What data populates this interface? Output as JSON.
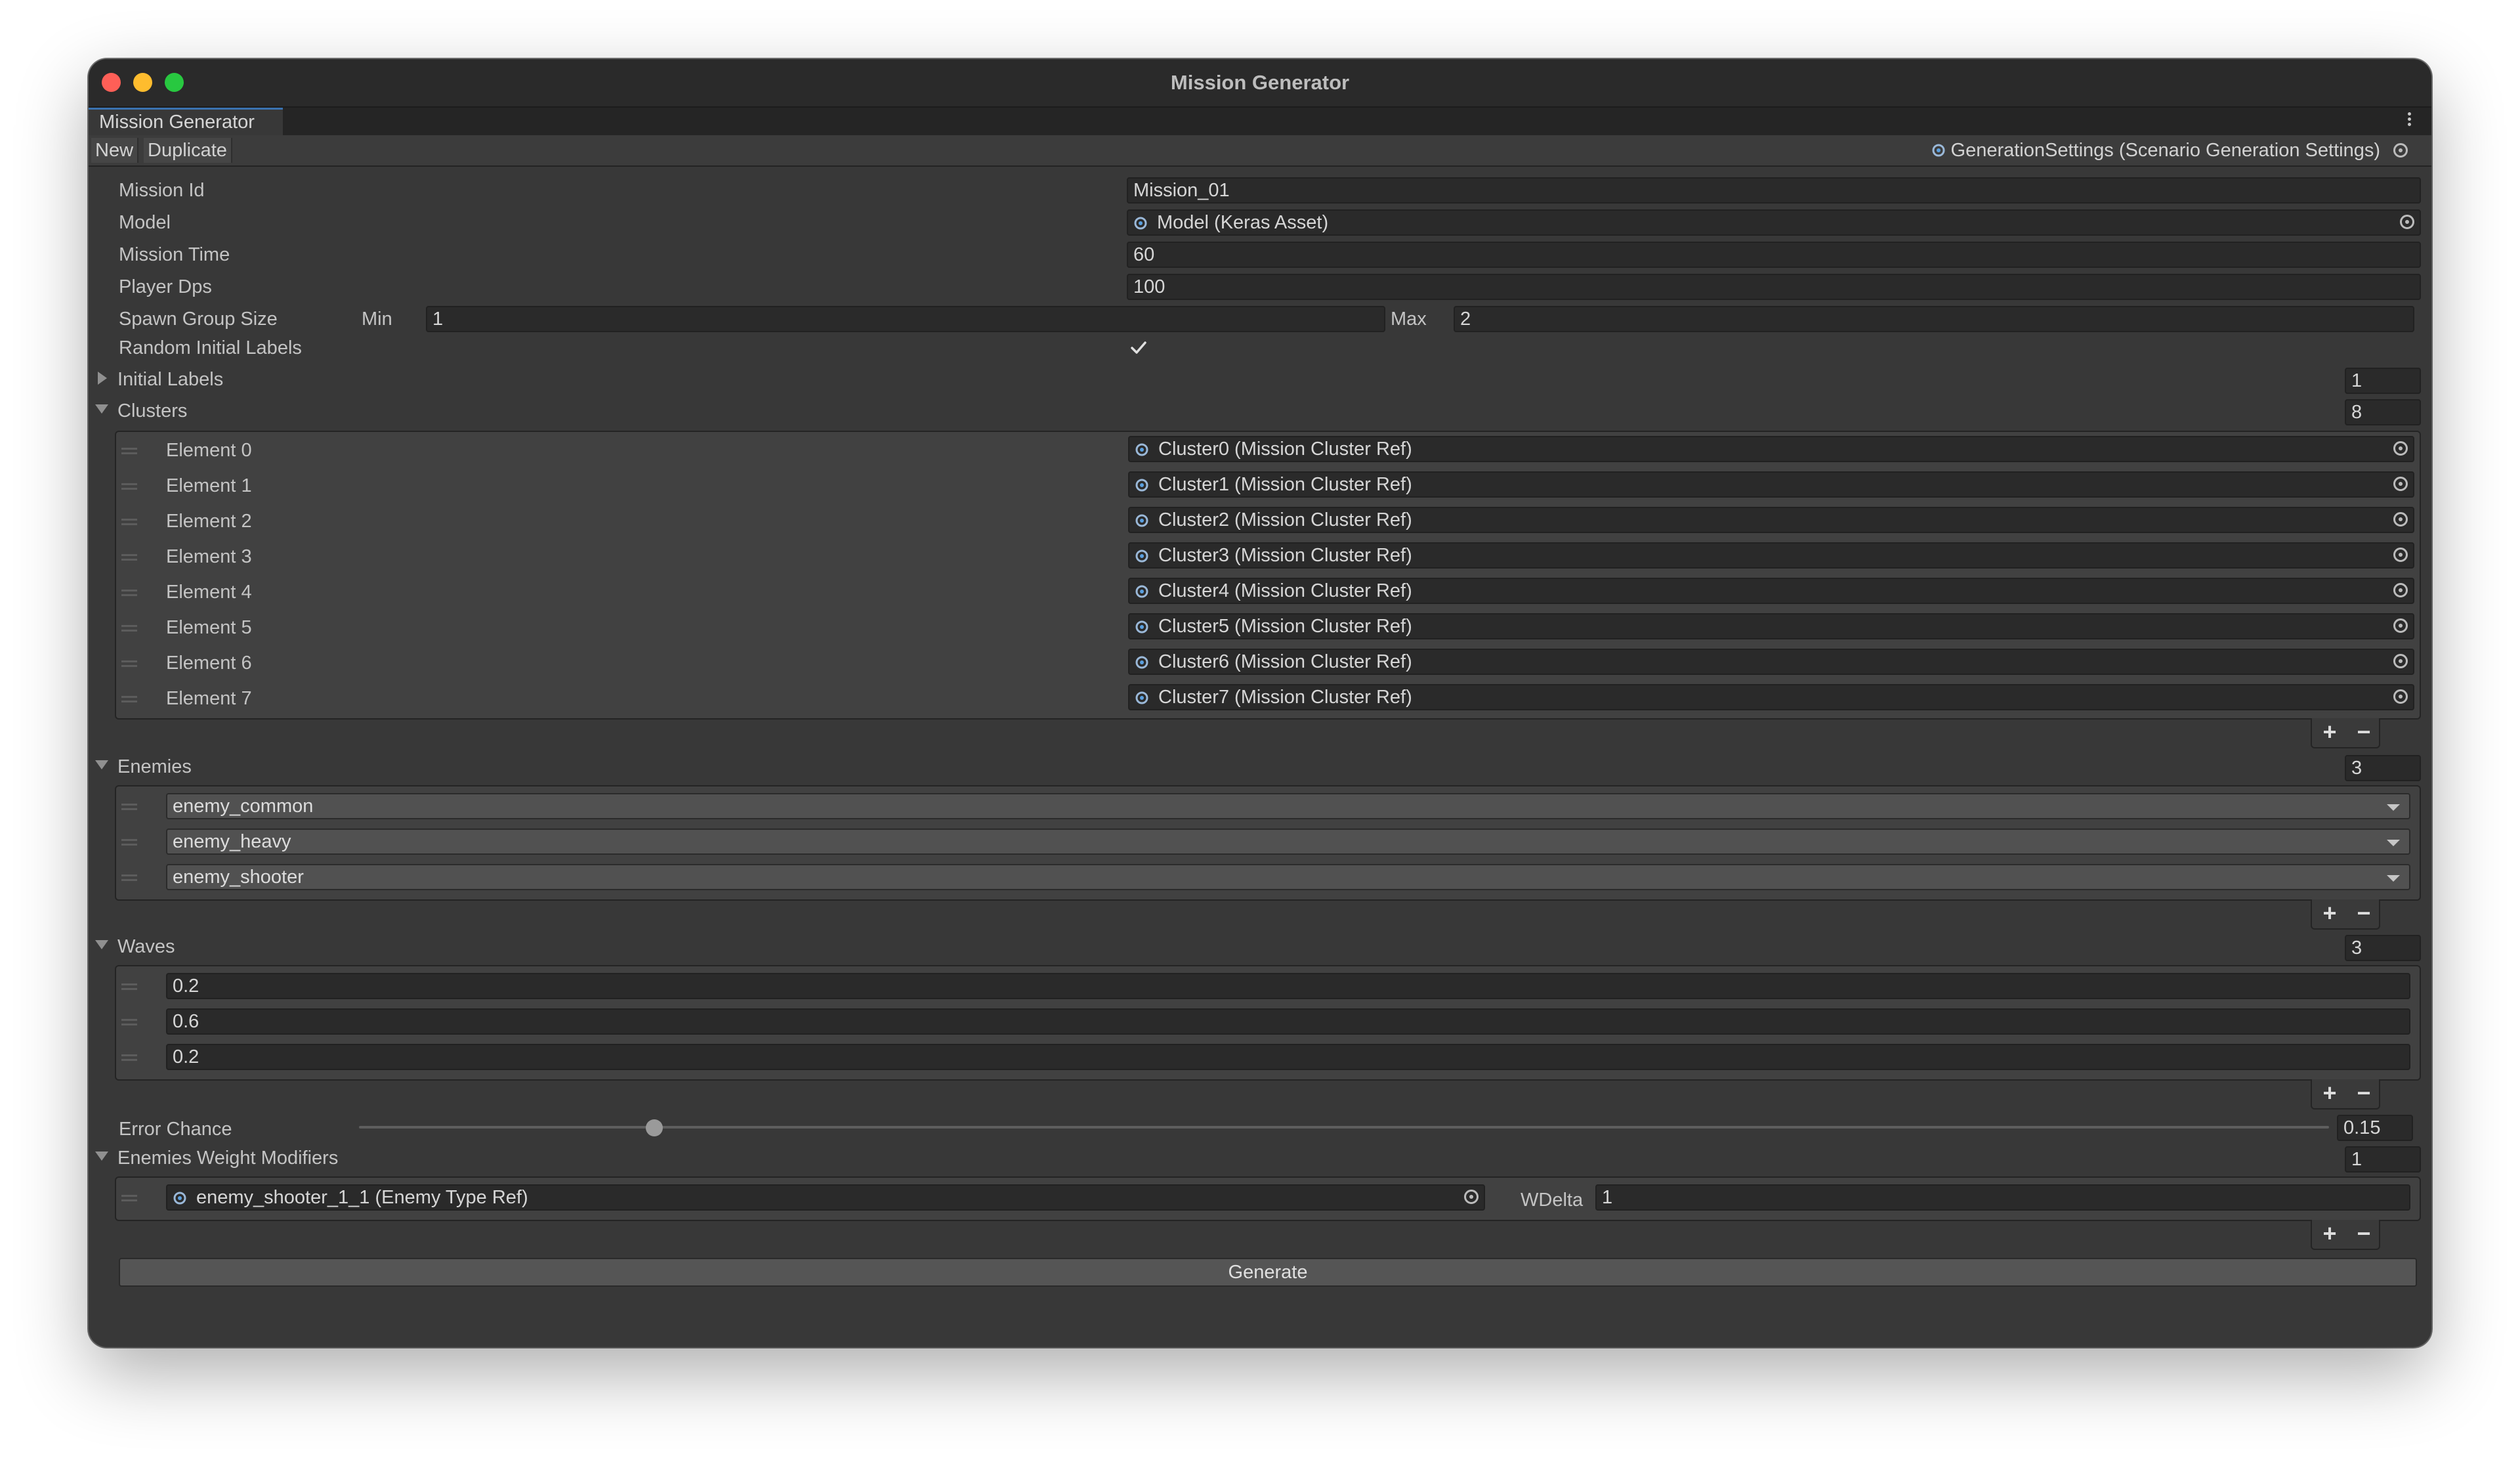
{
  "window": {
    "title": "Mission Generator"
  },
  "tab": {
    "label": "Mission Generator"
  },
  "toolbar": {
    "new_label": "New",
    "duplicate_label": "Duplicate",
    "settings_value": "GenerationSettings (Scenario Generation Settings)"
  },
  "fields": {
    "mission_id": {
      "label": "Mission Id",
      "value": "Mission_01"
    },
    "model": {
      "label": "Model",
      "value": "Model (Keras Asset)"
    },
    "mission_time": {
      "label": "Mission Time",
      "value": "60"
    },
    "player_dps": {
      "label": "Player Dps",
      "value": "100"
    },
    "spawn_group_size": {
      "label": "Spawn Group Size",
      "min_label": "Min",
      "min": "1",
      "max_label": "Max",
      "max": "2"
    },
    "random_initial_labels": {
      "label": "Random Initial Labels",
      "checked": true
    },
    "initial_labels": {
      "label": "Initial Labels",
      "count": "1"
    }
  },
  "clusters": {
    "label": "Clusters",
    "count": "8",
    "items": [
      {
        "name": "Element 0",
        "value": "Cluster0 (Mission Cluster Ref)"
      },
      {
        "name": "Element 1",
        "value": "Cluster1 (Mission Cluster Ref)"
      },
      {
        "name": "Element 2",
        "value": "Cluster2 (Mission Cluster Ref)"
      },
      {
        "name": "Element 3",
        "value": "Cluster3 (Mission Cluster Ref)"
      },
      {
        "name": "Element 4",
        "value": "Cluster4 (Mission Cluster Ref)"
      },
      {
        "name": "Element 5",
        "value": "Cluster5 (Mission Cluster Ref)"
      },
      {
        "name": "Element 6",
        "value": "Cluster6 (Mission Cluster Ref)"
      },
      {
        "name": "Element 7",
        "value": "Cluster7 (Mission Cluster Ref)"
      }
    ]
  },
  "enemies": {
    "label": "Enemies",
    "count": "3",
    "items": [
      "enemy_common",
      "enemy_heavy",
      "enemy_shooter"
    ]
  },
  "waves": {
    "label": "Waves",
    "count": "3",
    "items": [
      "0.2",
      "0.6",
      "0.2"
    ]
  },
  "error_chance": {
    "label": "Error Chance",
    "value": "0.15",
    "fraction": 0.15
  },
  "weight_modifiers": {
    "label": "Enemies Weight Modifiers",
    "count": "1",
    "items": [
      {
        "enemy": "enemy_shooter_1_1 (Enemy Type Ref)",
        "wdelta_label": "WDelta",
        "wdelta": "1"
      }
    ]
  },
  "list_buttons": {
    "plus": "+",
    "minus": "−"
  },
  "generate_label": "Generate",
  "colors": {
    "accent": "#3a72b0",
    "close": "#fe5f57",
    "minimize": "#febc2e",
    "maximize": "#28c840"
  },
  "icons": [
    "object-field-icon",
    "object-picker-icon",
    "foldout-arrow-icon",
    "drag-handle-icon",
    "dropdown-arrow-icon",
    "checkmark-icon",
    "kebab-menu-icon"
  ]
}
